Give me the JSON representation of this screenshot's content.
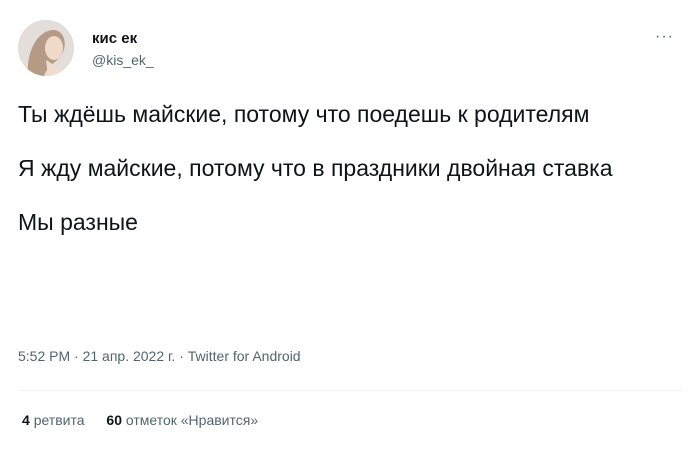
{
  "tweet": {
    "author_name": "кис ек",
    "author_handle": "@kis_ek_",
    "more_label": "···",
    "paragraphs": [
      "Ты ждёшь майские, потому что поедешь к родителям",
      "Я жду майские, потому что в праздники двойная ставка",
      "Мы разные"
    ],
    "time": "5:52 PM",
    "separator": " · ",
    "date": "21 апр. 2022 г.",
    "source": "Twitter for Android"
  },
  "stats": {
    "retweets_count": "4",
    "retweets_label": "ретвита",
    "likes_count": "60",
    "likes_label": "отметок «Нравится»"
  }
}
